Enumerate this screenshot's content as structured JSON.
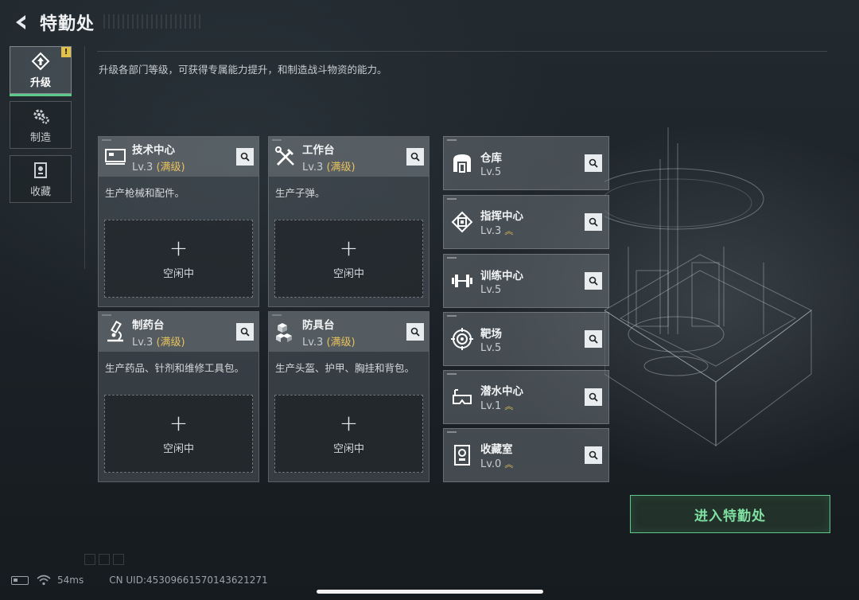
{
  "header": {
    "title": "特勤处"
  },
  "sidebar": {
    "tabs": [
      {
        "label": "升级",
        "icon": "upgrade-icon",
        "active": true,
        "badge": "!"
      },
      {
        "label": "制造",
        "icon": "gear-icon",
        "active": false
      },
      {
        "label": "收藏",
        "icon": "collection-icon",
        "active": false
      }
    ]
  },
  "description": "升级各部门等级，可获得专属能力提升，和制造战斗物资的能力。",
  "workshops": [
    {
      "name": "技术中心",
      "level": "Lv.3",
      "max_label": "(满级)",
      "desc": "生产枪械和配件。",
      "slot_label": "空闲中",
      "icon": "computer-icon"
    },
    {
      "name": "工作台",
      "level": "Lv.3",
      "max_label": "(满级)",
      "desc": "生产子弹。",
      "slot_label": "空闲中",
      "icon": "tools-icon"
    },
    {
      "name": "制药台",
      "level": "Lv.3",
      "max_label": "(满级)",
      "desc": "生产药品、针剂和维修工具包。",
      "slot_label": "空闲中",
      "icon": "microscope-icon"
    },
    {
      "name": "防具台",
      "level": "Lv.3",
      "max_label": "(满级)",
      "desc": "生产头盔、护甲、胸挂和背包。",
      "slot_label": "空闲中",
      "icon": "boxes-icon"
    }
  ],
  "facilities": [
    {
      "name": "仓库",
      "level": "Lv.5",
      "upgradeable": false,
      "icon": "warehouse-icon"
    },
    {
      "name": "指挥中心",
      "level": "Lv.3",
      "upgradeable": true,
      "icon": "chip-icon"
    },
    {
      "name": "训练中心",
      "level": "Lv.5",
      "upgradeable": false,
      "icon": "dumbbell-icon"
    },
    {
      "name": "靶场",
      "level": "Lv.5",
      "upgradeable": false,
      "icon": "target-icon"
    },
    {
      "name": "潜水中心",
      "level": "Lv.1",
      "upgradeable": true,
      "icon": "diving-mask-icon"
    },
    {
      "name": "收藏室",
      "level": "Lv.0",
      "upgradeable": true,
      "icon": "trophy-case-icon"
    }
  ],
  "enter_button": "进入特勤处",
  "status": {
    "ping": "54ms",
    "uid": "CN UID:45309661570143621271"
  },
  "colors": {
    "accent_green": "#5fc98a",
    "max_gold": "#e8c25c",
    "badge_yellow": "#e2c14a"
  }
}
